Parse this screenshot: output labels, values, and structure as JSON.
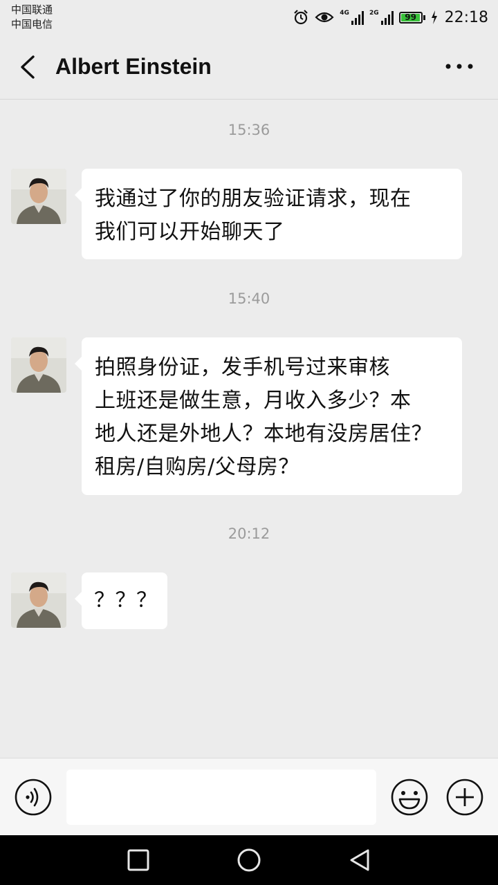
{
  "status_bar": {
    "carrier_1": "中国联通",
    "carrier_2": "中国电信",
    "net_1": "4G",
    "net_2": "2G",
    "battery_level": "99",
    "time": "22:18",
    "icons": [
      "alarm-icon",
      "eye-icon",
      "signal-icon",
      "signal-icon",
      "battery-icon",
      "charging-icon"
    ]
  },
  "header": {
    "title": "Albert Einstein",
    "back_icon": "back-chevron-icon",
    "more_icon": "more-dots-icon"
  },
  "messages": [
    {
      "timestamp": "15:36",
      "lines": [
        "我通过了你的朋友验证请求，现在",
        "我们可以开始聊天了"
      ]
    },
    {
      "timestamp": "15:40",
      "lines": [
        "拍照身份证，发手机号过来审核",
        "上班还是做生意，月收入多少？本",
        "地人还是外地人？本地有没房居住？",
        "租房/自购房/父母房？"
      ]
    },
    {
      "timestamp": "20:12",
      "lines": [
        "？？？"
      ]
    }
  ],
  "input_bar": {
    "voice_icon": "voice-icon",
    "input_value": "",
    "emoji_icon": "emoji-icon",
    "plus_icon": "plus-icon"
  },
  "nav_bar": {
    "icons": [
      "recent-apps-icon",
      "home-icon",
      "back-icon"
    ]
  },
  "colors": {
    "background": "#ececec",
    "bubble": "#ffffff",
    "timestamp": "#9b9b9b",
    "battery": "#38c23a"
  }
}
